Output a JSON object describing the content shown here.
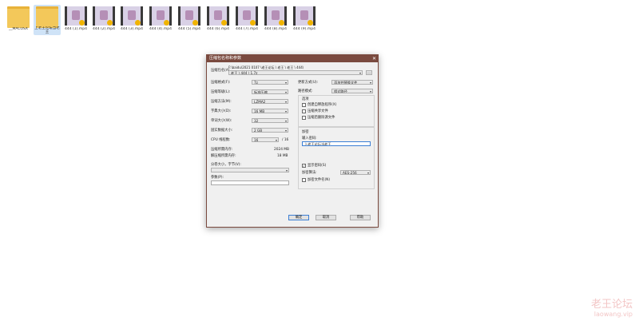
{
  "files": [
    {
      "name": "__MACOSX",
      "type": "folder",
      "selected": false
    },
    {
      "name": "上老王论坛当老王",
      "type": "folder",
      "selected": true
    },
    {
      "name": "444 (1).mp4",
      "type": "video",
      "selected": false
    },
    {
      "name": "444 (2).mp4",
      "type": "video",
      "selected": false
    },
    {
      "name": "444 (3).mp4",
      "type": "video",
      "selected": false
    },
    {
      "name": "444 (4).mp4",
      "type": "video",
      "selected": false
    },
    {
      "name": "444 (5).mp4",
      "type": "video",
      "selected": false
    },
    {
      "name": "444 (6).mp4",
      "type": "video",
      "selected": false
    },
    {
      "name": "444 (7).mp4",
      "type": "video",
      "selected": false
    },
    {
      "name": "444 (8).mp4",
      "type": "video",
      "selected": false
    },
    {
      "name": "444 (9).mp4",
      "type": "video",
      "selected": false
    }
  ],
  "dialog": {
    "title": "压缩包名称和参数",
    "close_glyph": "✕",
    "archive_name_label": "压缩包名(A)",
    "archive_path": "F:\\baidu\\2021 0107 \\老王论坛 \\ 老王 \\ 老王 \\ 444\\ ",
    "archive_name_value": "老王 \\ 444 \\ 1.7z",
    "browse_label": "...",
    "left": {
      "format_label": "压缩格式(F):",
      "format_value": "7z",
      "level_label": "压缩等级(L):",
      "level_value": "标准压缩",
      "method_label": "压缩方法(M):",
      "method_value": "LZMA2",
      "dict_label": "字典大小(D):",
      "dict_value": "16 MB",
      "word_label": "单词大小(W):",
      "word_value": "32",
      "solid_label": "固实数据大小:",
      "solid_value": "2 GB",
      "threads_label": "CPU 线程数:",
      "threads_value": "16",
      "threads_max": "/ 16",
      "mem_comp_label": "压缩所需内存:",
      "mem_comp_value": "2024 MB",
      "mem_decomp_label": "解压缩所需内存:",
      "mem_decomp_value": "18 MB",
      "split_label": "分卷大小，字节(V):",
      "params_label": "参数(P):"
    },
    "right": {
      "update_label": "更新方式(U):",
      "update_value": "添加并替换文件",
      "path_label": "路径模式:",
      "path_value": "相对路径",
      "options_title": "选项",
      "opt_sfx": "创建自释放程序(X)",
      "opt_shared": "压缩共享文件",
      "opt_delete": "压缩后删除源文件",
      "encryption_title": "加密",
      "password_label": "输入密码:",
      "password_value": "上老王论坛当老王",
      "show_password": "显示密码(S)",
      "enc_method_label": "加密算法:",
      "enc_method_value": "AES-256",
      "encrypt_names": "加密文件名(N)"
    },
    "buttons": {
      "ok": "确定",
      "cancel": "取消",
      "help": "帮助"
    }
  },
  "watermark": {
    "line1": "老王论坛",
    "line2": "laowang.vip"
  }
}
